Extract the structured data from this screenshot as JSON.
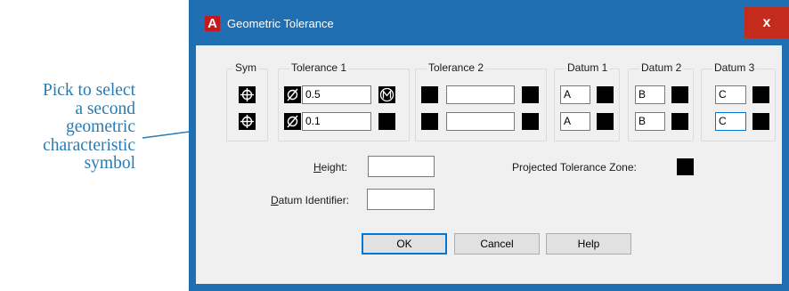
{
  "annotation": {
    "lines": [
      "Pick to select",
      "a second",
      "geometric",
      "characteristic",
      "symbol"
    ],
    "color": "#2a7bb3"
  },
  "window": {
    "title": "Geometric Tolerance",
    "app_icon_letter": "A",
    "close_glyph": "x",
    "titlebar_color": "#1f6fb2",
    "close_color": "#c42b1c"
  },
  "groups": {
    "sym": "Sym",
    "tolerance1": "Tolerance 1",
    "tolerance2": "Tolerance 2",
    "datum1": "Datum 1",
    "datum2": "Datum 2",
    "datum3": "Datum 3"
  },
  "rows": [
    {
      "symbol_icon": "position-symbol-icon",
      "dia_icon": "diameter-icon",
      "tolerance1": "0.5",
      "modifier_icon": "mmc-modifier-icon",
      "tolerance2": "",
      "datum1": "A",
      "datum2": "B",
      "datum3": "C"
    },
    {
      "symbol_icon": "position-symbol-icon",
      "dia_icon": "diameter-icon",
      "tolerance1": "0.1",
      "modifier_icon": "",
      "tolerance2": "",
      "datum1": "A",
      "datum2": "B",
      "datum3": "C"
    }
  ],
  "fields": {
    "height_label_u": "H",
    "height_label_rest": "eight:",
    "height_value": "",
    "datum_id_label_u": "D",
    "datum_id_label_rest": "atum Identifier:",
    "datum_id_value": "",
    "projected_label": "Projected Tolerance Zone:"
  },
  "buttons": {
    "ok": "OK",
    "cancel": "Cancel",
    "help": "Help"
  }
}
